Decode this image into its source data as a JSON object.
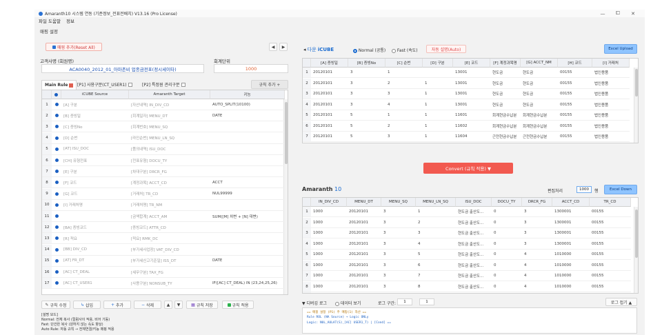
{
  "window": {
    "title": "Amaranth10 시스템 연동 (기준정보_전표전배치) V13.16 (Pro License)",
    "min": "—",
    "max": "⧠",
    "close": "✕"
  },
  "menu": [
    "파일 도움말",
    "정보"
  ],
  "left": {
    "section_title": "매핑 설정",
    "preset_button": "매핑 추가(Reset All)",
    "client_label": "고객사명 (회원명)",
    "client_value": "ACA0040_2012_01_아마존비 업종금전표(정시세이타)",
    "fiscal_label": "회계단위",
    "fiscal_value": "1000",
    "tabs": [
      {
        "label": "Main Rule",
        "checked": true
      },
      {
        "label": "[P1] 사용구분(CT_USER1)",
        "checked": false
      },
      {
        "label": "[P2] 특정원 관리구분",
        "checked": false
      }
    ],
    "rule_add_button": "규칙 추가 +",
    "columns": [
      "",
      "iCUBE Source",
      "Amaranth Target",
      "키능"
    ],
    "rows": [
      {
        "n": "1",
        "src": "[A] 구분",
        "tgt": "[자산내역] IN_DIV_CD",
        "fn": "AUTO_SPLIT(10100)"
      },
      {
        "n": "2",
        "src": "[B] 증빙일",
        "tgt": "[회계일자] MENU_DT",
        "fn": "DATE"
      },
      {
        "n": "3",
        "src": "[C] 증빙No",
        "tgt": "[회계번호] MENU_SQ",
        "fn": ""
      },
      {
        "n": "4",
        "src": "[D] 순번",
        "tgt": "[라인순번] MENU_LN_SQ",
        "fn": ""
      },
      {
        "n": "5",
        "src": "[AT] ISU_DOC",
        "tgt": "[품의내역] ISU_DOC",
        "fn": ""
      },
      {
        "n": "6",
        "src": "[CH] 유형전표",
        "tgt": "[전표유형] DOCU_TY",
        "fn": ""
      },
      {
        "n": "7",
        "src": "[E] 구분",
        "tgt": "[차대구분] DRCR_FG",
        "fn": ""
      },
      {
        "n": "8",
        "src": "[F] 코드",
        "tgt": "[계정과목] ACCT_CD",
        "fn": "ACCT"
      },
      {
        "n": "9",
        "src": "[G] 코드",
        "tgt": "[거래처] TR_CD",
        "fn": "NUL99999"
      },
      {
        "n": "10",
        "src": "[I] 거래처명",
        "tgt": "[거래처명] TR_NM",
        "fn": ""
      },
      {
        "n": "11",
        "src": "",
        "tgt": "[금액합계] ACCT_AM",
        "fn": "SUM([M] 차변 + [N] 대변)"
      },
      {
        "n": "12",
        "src": "[BA] 증빙코드",
        "tgt": "[증빙코드] ATTR_CD",
        "fn": ""
      },
      {
        "n": "13",
        "src": "[R] 적요",
        "tgt": "[적요] RMK_DC",
        "fn": ""
      },
      {
        "n": "14",
        "src": "[BB] DIV_CD",
        "tgt": "[부가세사업장] VAT_DIV_CD",
        "fn": ""
      },
      {
        "n": "15",
        "src": "[AT] FR_DT",
        "tgt": "[부가세신고기준일] ISS_DT",
        "fn": "DATE"
      },
      {
        "n": "16",
        "src": "[AC] CT_DEAL",
        "tgt": "[세무구분] TAX_FG",
        "fn": ""
      },
      {
        "n": "17",
        "src": "[AC] CT_USER1",
        "tgt": "[사용구분] NONSUB_TY",
        "fn": "IF([AC] CT_DEAL) IN (23,24,25,26)"
      }
    ],
    "toolbar": {
      "edit": "규칙 수정",
      "insert": "삽입",
      "add": "추가",
      "delete": "삭제",
      "up": "▲",
      "down": "▼",
      "save": "규칙 저장",
      "apply": "규칙 적용"
    },
    "help_title": "[설명 모드]",
    "help_lines": [
      "Normal: 전체 복사 (컬럼사이 적용, 비어 기동)",
      "Fast: 단건만 복사 (원하지 않는 속도 향상)",
      "Auto Rule: 자동 규칙 → 전체연결/키능 매핑 적용"
    ]
  },
  "right": {
    "src_title": "iCUBE",
    "src_prefix": "다운",
    "mode_normal": "Normal (공통)",
    "mode_fast": "Fast (속도)",
    "auto_rule": "자동 설명(Auto)",
    "excel_upload": "Excel Upload",
    "src_columns": [
      "",
      "[A] 증빙일",
      "[B] 증빙No",
      "[C] 순번",
      "[D] 구분",
      "[E] 코드",
      "[F] 계정과목명",
      "[G] ACCT_NM",
      "[H] 코드",
      "[I] 거래처"
    ],
    "src_rows": [
      [
        "1",
        "20120101",
        "3",
        "1",
        "",
        "13001",
        "현도금",
        "현도금",
        "00155",
        "법인용품"
      ],
      [
        "2",
        "20120101",
        "3",
        "2",
        "1",
        "13001",
        "현도금",
        "현도금",
        "00155",
        "법인용품"
      ],
      [
        "3",
        "20120101",
        "3",
        "3",
        "1",
        "13001",
        "현도금",
        "현도금",
        "00155",
        "법인용품"
      ],
      [
        "4",
        "20120101",
        "3",
        "4",
        "1",
        "13001",
        "현도금",
        "현도금",
        "00155",
        "법인용품"
      ],
      [
        "5",
        "20120101",
        "5",
        "1",
        "1",
        "11601",
        "회계현금수납분",
        "회계현금수납분",
        "00155",
        "법인용품"
      ],
      [
        "6",
        "20120101",
        "5",
        "2",
        "1",
        "11602",
        "회계현금수납분",
        "회계현금수납분",
        "00155",
        "법인용품"
      ],
      [
        "7",
        "20120101",
        "5",
        "3",
        "1",
        "11604",
        "근전현금수납분",
        "근전현금수납분",
        "00155",
        "법인용품"
      ]
    ],
    "convert": "Convert (규칙 적용) ▼",
    "tgt_title": "Amaranth",
    "tgt_count": "10",
    "page_label": "편집처리",
    "page_value": "1000",
    "page_unit": "행",
    "excel_down": "Excel Down",
    "tgt_columns": [
      "",
      "IN_DIV_CD",
      "MENU_DT",
      "MENU_SQ",
      "MENU_LN_SQ",
      "ISU_DOC",
      "DOCU_TY",
      "DRCR_FG",
      "ACCT_CD",
      "TR_CD"
    ],
    "tgt_rows": [
      [
        "1",
        "1000",
        "20120101",
        "3",
        "1",
        "현도금 출산도...",
        "0",
        "3",
        "1300001",
        "00155"
      ],
      [
        "2",
        "1000",
        "20120101",
        "3",
        "2",
        "현도금 출산도...",
        "0",
        "3",
        "1300001",
        "00155"
      ],
      [
        "3",
        "1000",
        "20120101",
        "3",
        "3",
        "현도금 출산도...",
        "0",
        "3",
        "1300001",
        "00155"
      ],
      [
        "4",
        "1000",
        "20120101",
        "3",
        "4",
        "현도금 출산도...",
        "0",
        "3",
        "1300001",
        "00155"
      ],
      [
        "5",
        "1000",
        "20120101",
        "3",
        "5",
        "현도금 출산도...",
        "0",
        "4",
        "1010000",
        "00155"
      ],
      [
        "6",
        "1000",
        "20120101",
        "3",
        "6",
        "현도금 출산도...",
        "0",
        "4",
        "1010000",
        "00155"
      ],
      [
        "7",
        "1000",
        "20120101",
        "3",
        "7",
        "현도금 출산도...",
        "0",
        "4",
        "1010000",
        "00155"
      ],
      [
        "8",
        "1000",
        "20120101",
        "3",
        "8",
        "현도금 출산도...",
        "0",
        "4",
        "1010000",
        "00155"
      ],
      [
        "9",
        "1000",
        "20120101",
        "5",
        "1",
        "현금수납마수...",
        "0",
        "3",
        "1100001",
        "00155"
      ],
      [
        "10",
        "1000",
        "20120101",
        "5",
        "2",
        "현금수납마수...",
        "0",
        "3",
        "1100001",
        "00155"
      ]
    ],
    "log": {
      "label": "▼ 디버깅 로그",
      "detail": "데이터 보기",
      "level_label": "로그 구간:",
      "from": "1",
      "to": "1",
      "collapse": "로그 접기 ▲",
      "lines": [
        "== 매핑 설정 (P1) 주 매핑(1) 자산 ==",
        "Rule ROL (NA Source) → Logic ONLy",
        "Logic: NUL_AULAT(S)_[AC] USER1_T) | [Cond] =="
      ]
    }
  }
}
